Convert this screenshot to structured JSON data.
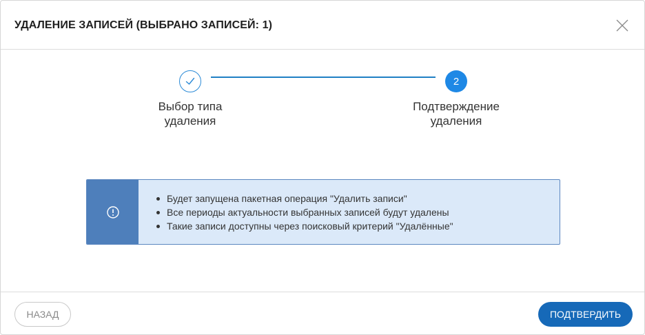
{
  "dialog": {
    "title": "УДАЛЕНИЕ ЗАПИСЕЙ (ВЫБРАНО ЗАПИСЕЙ: 1)",
    "close_icon": "close-icon"
  },
  "stepper": {
    "steps": [
      {
        "label": "Выбор типа удаления",
        "state": "completed",
        "icon": "check-icon"
      },
      {
        "label": "Подтверждение удаления",
        "state": "active",
        "number": "2"
      }
    ]
  },
  "info": {
    "icon": "exclamation-circle-icon",
    "items": [
      "Будет запущена пакетная операция \"Удалить записи\"",
      "Все периоды актуальности выбранных записей будут удалены",
      "Такие записи доступны через поисковый критерий \"Удалённые\""
    ]
  },
  "footer": {
    "back_label": "НАЗАД",
    "confirm_label": "ПОДТВЕРДИТЬ"
  },
  "colors": {
    "primary": "#1669b8",
    "step_active": "#1e88e5",
    "info_side": "#4e7fbb",
    "info_bg": "#dbe9f9"
  }
}
